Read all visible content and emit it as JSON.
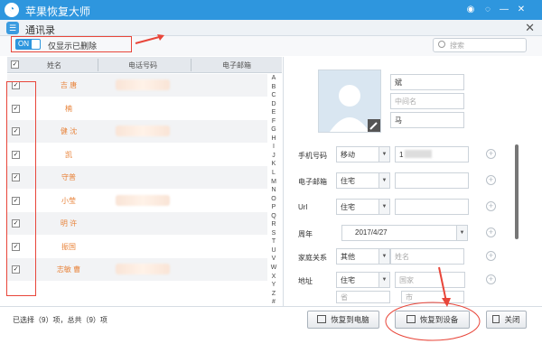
{
  "app": {
    "title": "苹果恢复大师"
  },
  "window": {
    "title": "通讯录"
  },
  "toolbar": {
    "toggle": "ON",
    "toggle_label": "仅显示已删除",
    "search_placeholder": "搜索"
  },
  "table": {
    "headers": [
      "姓名",
      "电话号码",
      "电子邮箱"
    ],
    "rows": [
      {
        "name": "吉 唐",
        "checked": true
      },
      {
        "name": "楠",
        "checked": true
      },
      {
        "name": "健 沈",
        "checked": true
      },
      {
        "name": "凯",
        "checked": true
      },
      {
        "name": "守普 ",
        "checked": true
      },
      {
        "name": "小莹 ",
        "checked": true
      },
      {
        "name": "明 许",
        "checked": true
      },
      {
        "name": "振国 ",
        "checked": true
      },
      {
        "name": "志敏 曹",
        "checked": true
      }
    ],
    "alphabet": [
      "A",
      "B",
      "C",
      "D",
      "E",
      "F",
      "G",
      "H",
      "I",
      "J",
      "K",
      "L",
      "M",
      "N",
      "O",
      "P",
      "Q",
      "R",
      "S",
      "T",
      "U",
      "V",
      "W",
      "X",
      "Y",
      "Z",
      "#"
    ]
  },
  "detail": {
    "first_name": "斌",
    "middle_placeholder": "中间名",
    "last_name": "马",
    "phone_label": "手机号码",
    "phone_type": "移动",
    "phone_value": "1",
    "email_label": "电子邮箱",
    "email_type": "住宅",
    "url_label": "Url",
    "url_type": "住宅",
    "anniv_label": "周年",
    "anniv_value": "2017/4/27",
    "family_label": "家庭关系",
    "family_type": "其他",
    "family_placeholder": "姓名",
    "addr_label": "地址",
    "addr_type": "住宅",
    "country_placeholder": "国家",
    "province_placeholder": "省",
    "city_placeholder": "市"
  },
  "status": "已选择（9）项，总共（9）项",
  "buttons": {
    "to_pc": "恢复到电脑",
    "to_device": "恢复到设备",
    "close": "关闭"
  },
  "colors": {
    "accent": "#2e96de",
    "name": "#e8833a",
    "highlight": "#e8463a"
  }
}
